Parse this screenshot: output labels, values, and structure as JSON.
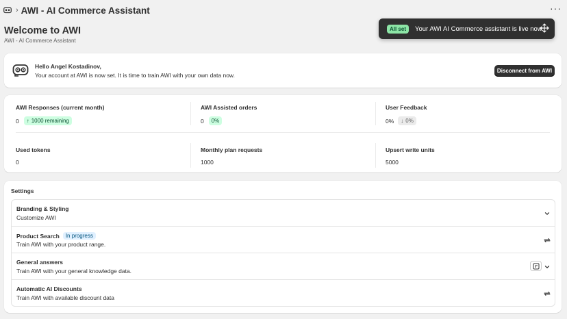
{
  "app": {
    "title": "AWI - AI Commerce Assistant",
    "more_icon": "more-dots-icon"
  },
  "toast": {
    "badge": "All set",
    "message": "Your AWI AI Commerce assistant is live now."
  },
  "page": {
    "title": "Welcome to AWI",
    "subtitle": "AWI - AI Commerce Assistant"
  },
  "hello": {
    "greeting": "Hello Angel Kostadinov,",
    "message": "Your account at AWI is now set. It is time to train AWI with your own data now.",
    "disconnect_label": "Disconnect from AWI"
  },
  "stats": {
    "responses": {
      "label": "AWI Responses (current month)",
      "value": "0",
      "badge": "1000 remaining"
    },
    "orders": {
      "label": "AWI Assisted orders",
      "value": "0",
      "badge": "0%"
    },
    "feedback": {
      "label": "User Feedback",
      "value": "0%",
      "badge": "0%"
    },
    "tokens": {
      "label": "Used tokens",
      "value": "0"
    },
    "plan_requests": {
      "label": "Monthly plan requests",
      "value": "1000"
    },
    "upsert": {
      "label": "Upsert write units",
      "value": "5000"
    }
  },
  "settings": {
    "title": "Settings",
    "rows": [
      {
        "title": "Branding & Styling",
        "desc": "Customize AWI",
        "icon": "chevron-down-icon"
      },
      {
        "title": "Product Search",
        "badge": "In progress",
        "desc": "Train AWI with your product range.",
        "icon": "refresh-icon"
      },
      {
        "title": "General answers",
        "desc": "Train AWI with your general knowledge data.",
        "icon": "chevron-down-icon",
        "extra_icon": "edit-note-icon"
      },
      {
        "title": "Automatic AI Discounts",
        "desc": "Train AWI with available discount data",
        "icon": "refresh-icon"
      }
    ]
  },
  "colors": {
    "primary_dark": "#303030",
    "success_bg": "#cdfee1",
    "toast_badge": "#8de5a6",
    "info_bg": "#e0f0ff",
    "page_bg": "#f1f1f1"
  }
}
